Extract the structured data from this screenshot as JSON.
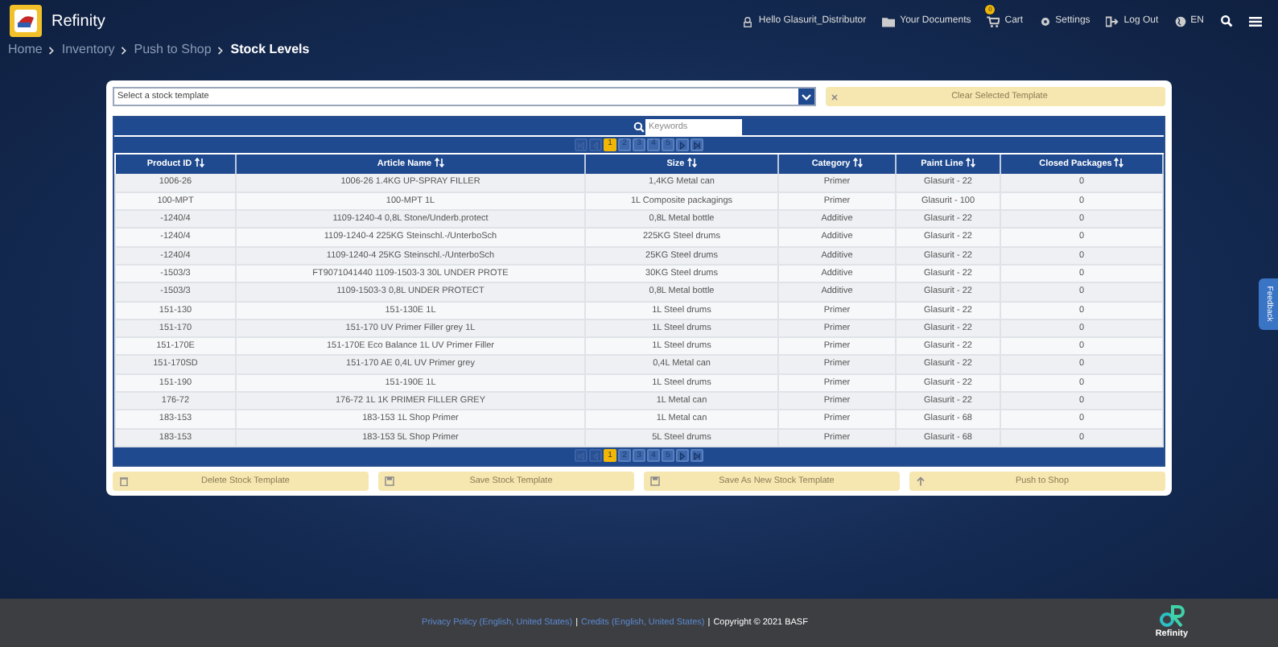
{
  "app": {
    "title": "Refinity"
  },
  "nav": [
    {
      "kind": "user",
      "label": "Hello Glasurit_Distributor"
    },
    {
      "kind": "docs",
      "label": "Your Documents"
    },
    {
      "kind": "cart",
      "label": "Cart",
      "badge": "0"
    },
    {
      "kind": "settings",
      "label": "Settings"
    },
    {
      "kind": "logout",
      "label": "Log Out"
    },
    {
      "kind": "lang",
      "label": "EN"
    },
    {
      "kind": "search"
    },
    {
      "kind": "menu"
    }
  ],
  "breadcrumb": [
    {
      "label": "Home",
      "current": false
    },
    {
      "label": "Inventory",
      "current": false
    },
    {
      "label": "Push to Shop",
      "current": false
    },
    {
      "label": "Stock Levels",
      "current": true
    }
  ],
  "template_select": {
    "placeholder": "Select a stock template"
  },
  "clear_button": {
    "label": "Clear Selected Template",
    "disabled": true
  },
  "search": {
    "placeholder": "Keywords"
  },
  "pagination_top": [
    {
      "kind": "first",
      "disabled": true
    },
    {
      "kind": "prev",
      "disabled": true
    },
    {
      "kind": "page",
      "label": "1",
      "selected": true
    },
    {
      "kind": "page",
      "label": "2",
      "selected": false
    },
    {
      "kind": "page",
      "label": "3",
      "selected": false
    },
    {
      "kind": "page",
      "label": "4",
      "selected": false
    },
    {
      "kind": "page",
      "label": "5",
      "selected": false
    },
    {
      "kind": "next",
      "disabled": false
    },
    {
      "kind": "last",
      "disabled": false
    }
  ],
  "pagination_bottom": [
    {
      "kind": "first",
      "disabled": true
    },
    {
      "kind": "prev",
      "disabled": true
    },
    {
      "kind": "page",
      "label": "1",
      "selected": true
    },
    {
      "kind": "page",
      "label": "2",
      "selected": false
    },
    {
      "kind": "page",
      "label": "3",
      "selected": false
    },
    {
      "kind": "page",
      "label": "4",
      "selected": false
    },
    {
      "kind": "page",
      "label": "5",
      "selected": false
    },
    {
      "kind": "next",
      "disabled": false
    },
    {
      "kind": "last",
      "disabled": false
    }
  ],
  "table": {
    "columns": [
      "Product ID",
      "Article Name",
      "Size",
      "Category",
      "Paint Line",
      "Closed Packages"
    ],
    "rows": [
      [
        "1006-26",
        "1006-26 1.4KG UP-SPRAY FILLER",
        "1,4KG Metal can",
        "Primer",
        "Glasurit - 22",
        "0"
      ],
      [
        "100-MPT",
        "100-MPT 1L",
        "1L Composite packagings",
        "Primer",
        "Glasurit - 100",
        "0"
      ],
      [
        "-1240/4",
        "1109-1240-4 0,8L Stone/Underb.protect",
        "0,8L Metal bottle",
        "Additive",
        "Glasurit - 22",
        "0"
      ],
      [
        "-1240/4",
        "1109-1240-4 225KG Steinschl.-/UnterboSch",
        "225KG Steel drums",
        "Additive",
        "Glasurit - 22",
        "0"
      ],
      [
        "-1240/4",
        "1109-1240-4 25KG Steinschl.-/UnterboSch",
        "25KG Steel drums",
        "Additive",
        "Glasurit - 22",
        "0"
      ],
      [
        "-1503/3",
        "FT9071041440 1109-1503-3 30L UNDER PROTE",
        "30KG Steel drums",
        "Additive",
        "Glasurit - 22",
        "0"
      ],
      [
        "-1503/3",
        "1109-1503-3 0,8L UNDER PROTECT",
        "0,8L Metal bottle",
        "Additive",
        "Glasurit - 22",
        "0"
      ],
      [
        "151-130",
        "151-130E 1L",
        "1L Steel drums",
        "Primer",
        "Glasurit - 22",
        "0"
      ],
      [
        "151-170",
        "151-170 UV Primer Filler grey 1L",
        "1L Steel drums",
        "Primer",
        "Glasurit - 22",
        "0"
      ],
      [
        "151-170E",
        "151-170E Eco Balance 1L UV Primer Filler",
        "1L Steel drums",
        "Primer",
        "Glasurit - 22",
        "0"
      ],
      [
        "151-170SD",
        "151-170 AE 0,4L UV Primer grey",
        "0,4L Metal can",
        "Primer",
        "Glasurit - 22",
        "0"
      ],
      [
        "151-190",
        "151-190E 1L",
        "1L Steel drums",
        "Primer",
        "Glasurit - 22",
        "0"
      ],
      [
        "176-72",
        "176-72 1L 1K PRIMER FILLER GREY",
        "1L Metal can",
        "Primer",
        "Glasurit - 22",
        "0"
      ],
      [
        "183-153",
        "183-153 1L Shop Primer",
        "1L Metal can",
        "Primer",
        "Glasurit - 68",
        "0"
      ],
      [
        "183-153",
        "183-153 5L Shop Primer",
        "5L Steel drums",
        "Primer",
        "Glasurit - 68",
        "0"
      ]
    ]
  },
  "actions": [
    {
      "kind": "delete",
      "label": "Delete Stock Template",
      "disabled": true
    },
    {
      "kind": "save",
      "label": "Save Stock Template",
      "disabled": true
    },
    {
      "kind": "save",
      "label": "Save As New Stock Template",
      "disabled": true
    },
    {
      "kind": "push",
      "label": "Push to Shop",
      "disabled": true
    }
  ],
  "feedback_tab": "Feedback",
  "footer": {
    "items": [
      {
        "kind": "link",
        "text": "Privacy Policy (English, United States)"
      },
      {
        "kind": "separator",
        "text": "|"
      },
      {
        "kind": "link",
        "text": "Credits (English, United States)"
      },
      {
        "kind": "separator",
        "text": "|"
      },
      {
        "kind": "text",
        "text": "Copyright © 2021 BASF"
      }
    ],
    "logo_text": "Refinity"
  }
}
